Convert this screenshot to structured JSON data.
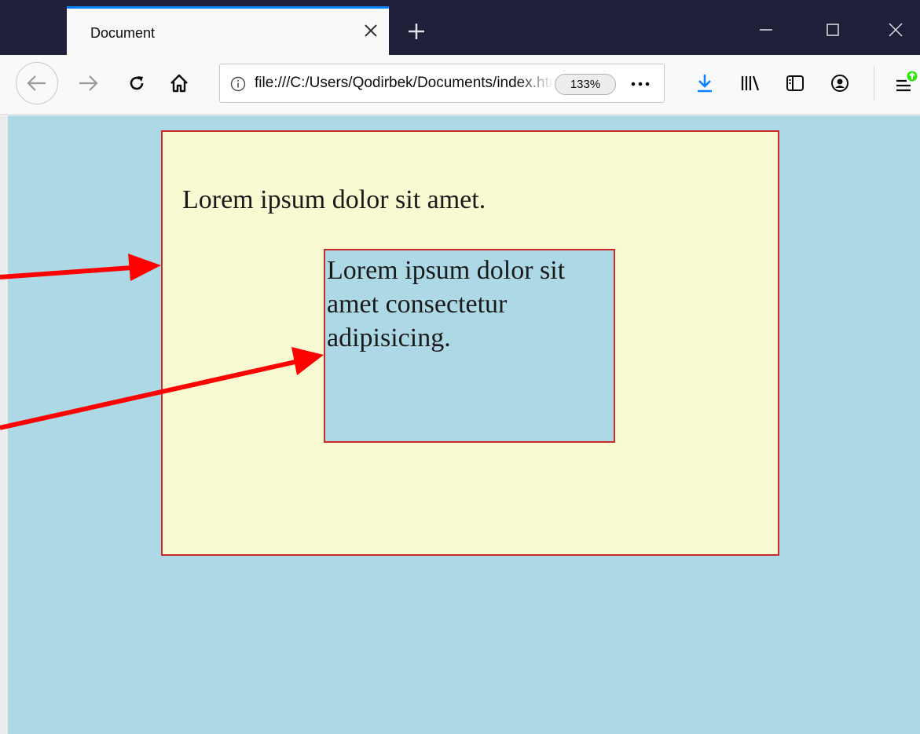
{
  "browser": {
    "tab": {
      "title": "Document"
    },
    "address_bar": {
      "url": "file:///C:/Users/Qodirbek/Documents/index.html",
      "zoom": "133%"
    },
    "accent_color": "#0a84ff"
  },
  "icons": {
    "tab_close": "close-icon",
    "new_tab": "plus-icon",
    "back": "back-arrow-icon",
    "forward": "forward-arrow-icon",
    "reload": "reload-icon",
    "home": "home-icon",
    "info": "info-icon",
    "page_actions": "more-icon",
    "downloads": "download-icon",
    "library": "library-icon",
    "sidebar": "sidebar-icon",
    "account": "account-icon",
    "menu": "hamburger-menu-icon",
    "minimize": "minimize-icon",
    "maximize": "maximize-icon",
    "close": "window-close-icon"
  },
  "page": {
    "background_color": "#add8e6",
    "outer_box": {
      "text": "Lorem ipsum dolor sit amet.",
      "background_color": "#fafad2",
      "border_color": "#cc2a2a"
    },
    "inner_box": {
      "text": "Lorem ipsum dolor sit amet consectetur adipisicing.",
      "background_color": "#add8e6",
      "border_color": "#cc2a2a"
    }
  },
  "annotations": {
    "arrow_color": "#ff0000"
  }
}
